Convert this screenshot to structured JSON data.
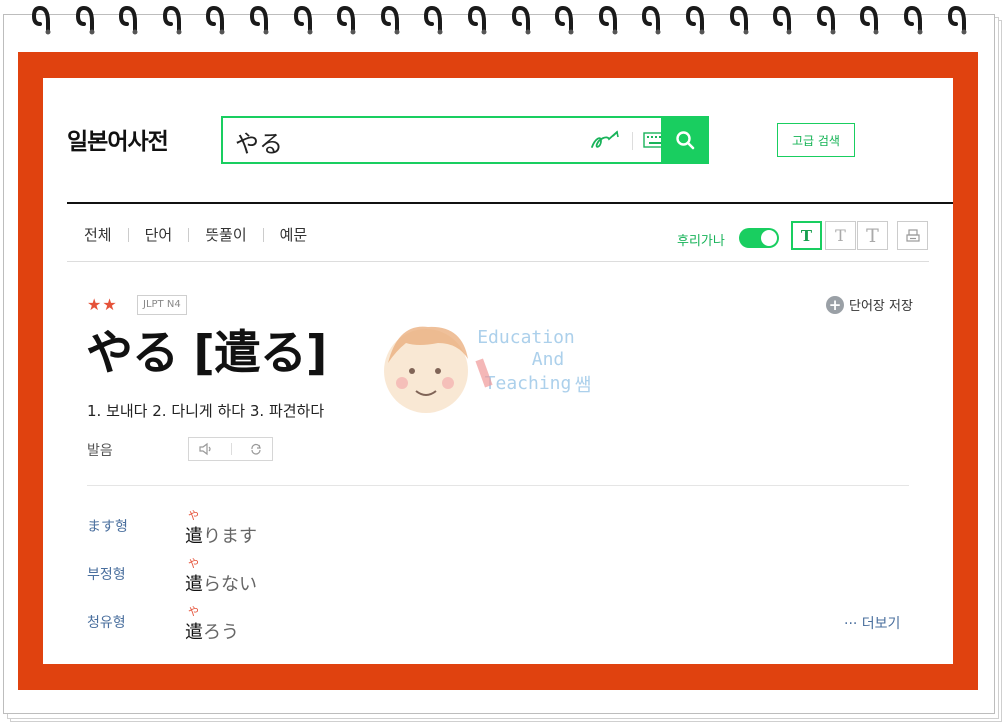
{
  "header": {
    "logo": "일본어사전",
    "search_value": "やる",
    "advanced_label": "고급 검색"
  },
  "tabs": [
    "전체",
    "단어",
    "뜻풀이",
    "예문"
  ],
  "furigana_label": "후리가나",
  "text_size_buttons": [
    "T",
    "T",
    "T"
  ],
  "entry": {
    "stars": "★★",
    "jlpt": "JLPT N4",
    "save_label": "단어장 저장",
    "headword": "やる [遣る]",
    "meaning": "1. 보내다 2. 다니게 하다 3. 파견하다",
    "pron_label": "발음"
  },
  "conjugations": [
    {
      "label": "ます형",
      "ruby": "や",
      "kanji": "遣",
      "rest": "ります"
    },
    {
      "label": "부정형",
      "ruby": "や",
      "kanji": "遣",
      "rest": "らない"
    },
    {
      "label": "청유형",
      "ruby": "や",
      "kanji": "遣",
      "rest": "ろう"
    }
  ],
  "more_label": "··· 더보기",
  "watermark": {
    "line1": "Education",
    "line2": "And",
    "line3": "Teaching",
    "suffix": "쌤"
  },
  "colors": {
    "frame": "#e0420f",
    "accent_green": "#19ce60",
    "star_red": "#e55239",
    "label_blue": "#4a6f9e"
  }
}
